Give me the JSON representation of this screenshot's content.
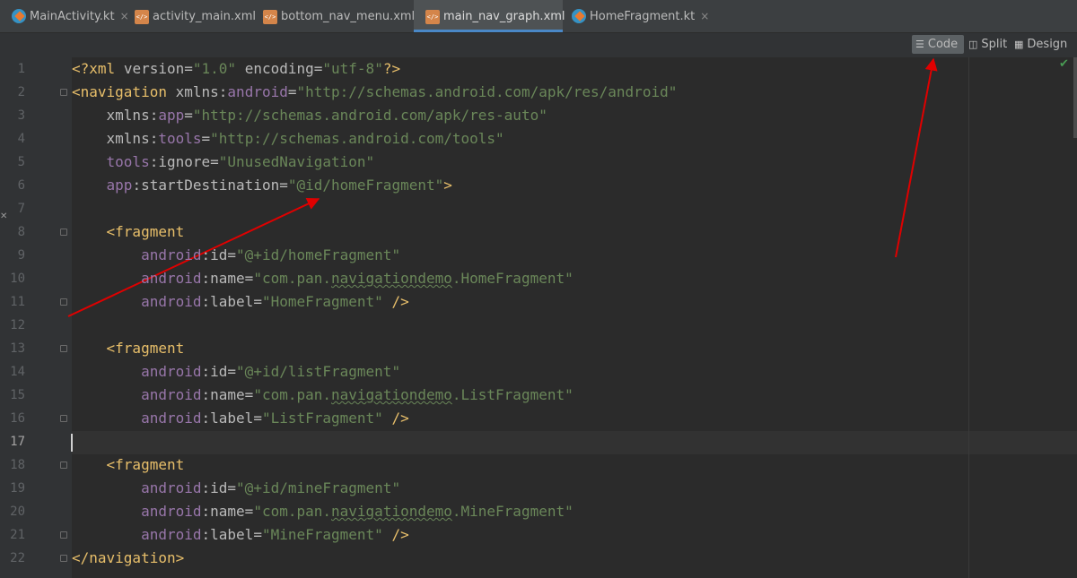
{
  "tabs": [
    {
      "label": "MainActivity.kt",
      "icon": "kotlin-file-icon",
      "close": "×"
    },
    {
      "label": "activity_main.xml",
      "icon": "xml-file-icon",
      "close": "×"
    },
    {
      "label": "bottom_nav_menu.xml",
      "icon": "xml-file-icon",
      "close": "×"
    },
    {
      "label": "main_nav_graph.xml",
      "icon": "xml-file-icon",
      "close": "×",
      "active": true
    },
    {
      "label": "HomeFragment.kt",
      "icon": "kotlin-file-icon",
      "close": "×"
    }
  ],
  "view_modes": [
    {
      "label": "Code",
      "icon": "code-view-icon",
      "active": true
    },
    {
      "label": "Split",
      "icon": "split-view-icon"
    },
    {
      "label": "Design",
      "icon": "design-view-icon"
    }
  ],
  "colors": {
    "tag": "#e8bf6a",
    "attribute": "#bababa",
    "namespace": "#9876aa",
    "string": "#6a8759",
    "text": "#a9b7c6",
    "annotation_arrow": "#e00000"
  },
  "editor": {
    "current_line": 17,
    "lines": [
      {
        "n": 1,
        "text": "<?xml version=\"1.0\" encoding=\"utf-8\"?>"
      },
      {
        "n": 2,
        "text": "<navigation xmlns:android=\"http://schemas.android.com/apk/res/android\""
      },
      {
        "n": 3,
        "text": "    xmlns:app=\"http://schemas.android.com/apk/res-auto\""
      },
      {
        "n": 4,
        "text": "    xmlns:tools=\"http://schemas.android.com/tools\""
      },
      {
        "n": 5,
        "text": "    tools:ignore=\"UnusedNavigation\""
      },
      {
        "n": 6,
        "text": "    app:startDestination=\"@id/homeFragment\">"
      },
      {
        "n": 7,
        "text": ""
      },
      {
        "n": 8,
        "text": "    <fragment"
      },
      {
        "n": 9,
        "text": "        android:id=\"@+id/homeFragment\""
      },
      {
        "n": 10,
        "text": "        android:name=\"com.pan.navigationdemo.HomeFragment\""
      },
      {
        "n": 11,
        "text": "        android:label=\"HomeFragment\" />"
      },
      {
        "n": 12,
        "text": ""
      },
      {
        "n": 13,
        "text": "    <fragment"
      },
      {
        "n": 14,
        "text": "        android:id=\"@+id/listFragment\""
      },
      {
        "n": 15,
        "text": "        android:name=\"com.pan.navigationdemo.ListFragment\""
      },
      {
        "n": 16,
        "text": "        android:label=\"ListFragment\" />"
      },
      {
        "n": 17,
        "text": ""
      },
      {
        "n": 18,
        "text": "    <fragment"
      },
      {
        "n": 19,
        "text": "        android:id=\"@+id/mineFragment\""
      },
      {
        "n": 20,
        "text": "        android:name=\"com.pan.navigationdemo.MineFragment\""
      },
      {
        "n": 21,
        "text": "        android:label=\"MineFragment\" />"
      },
      {
        "n": 22,
        "text": "</navigation>"
      }
    ]
  }
}
